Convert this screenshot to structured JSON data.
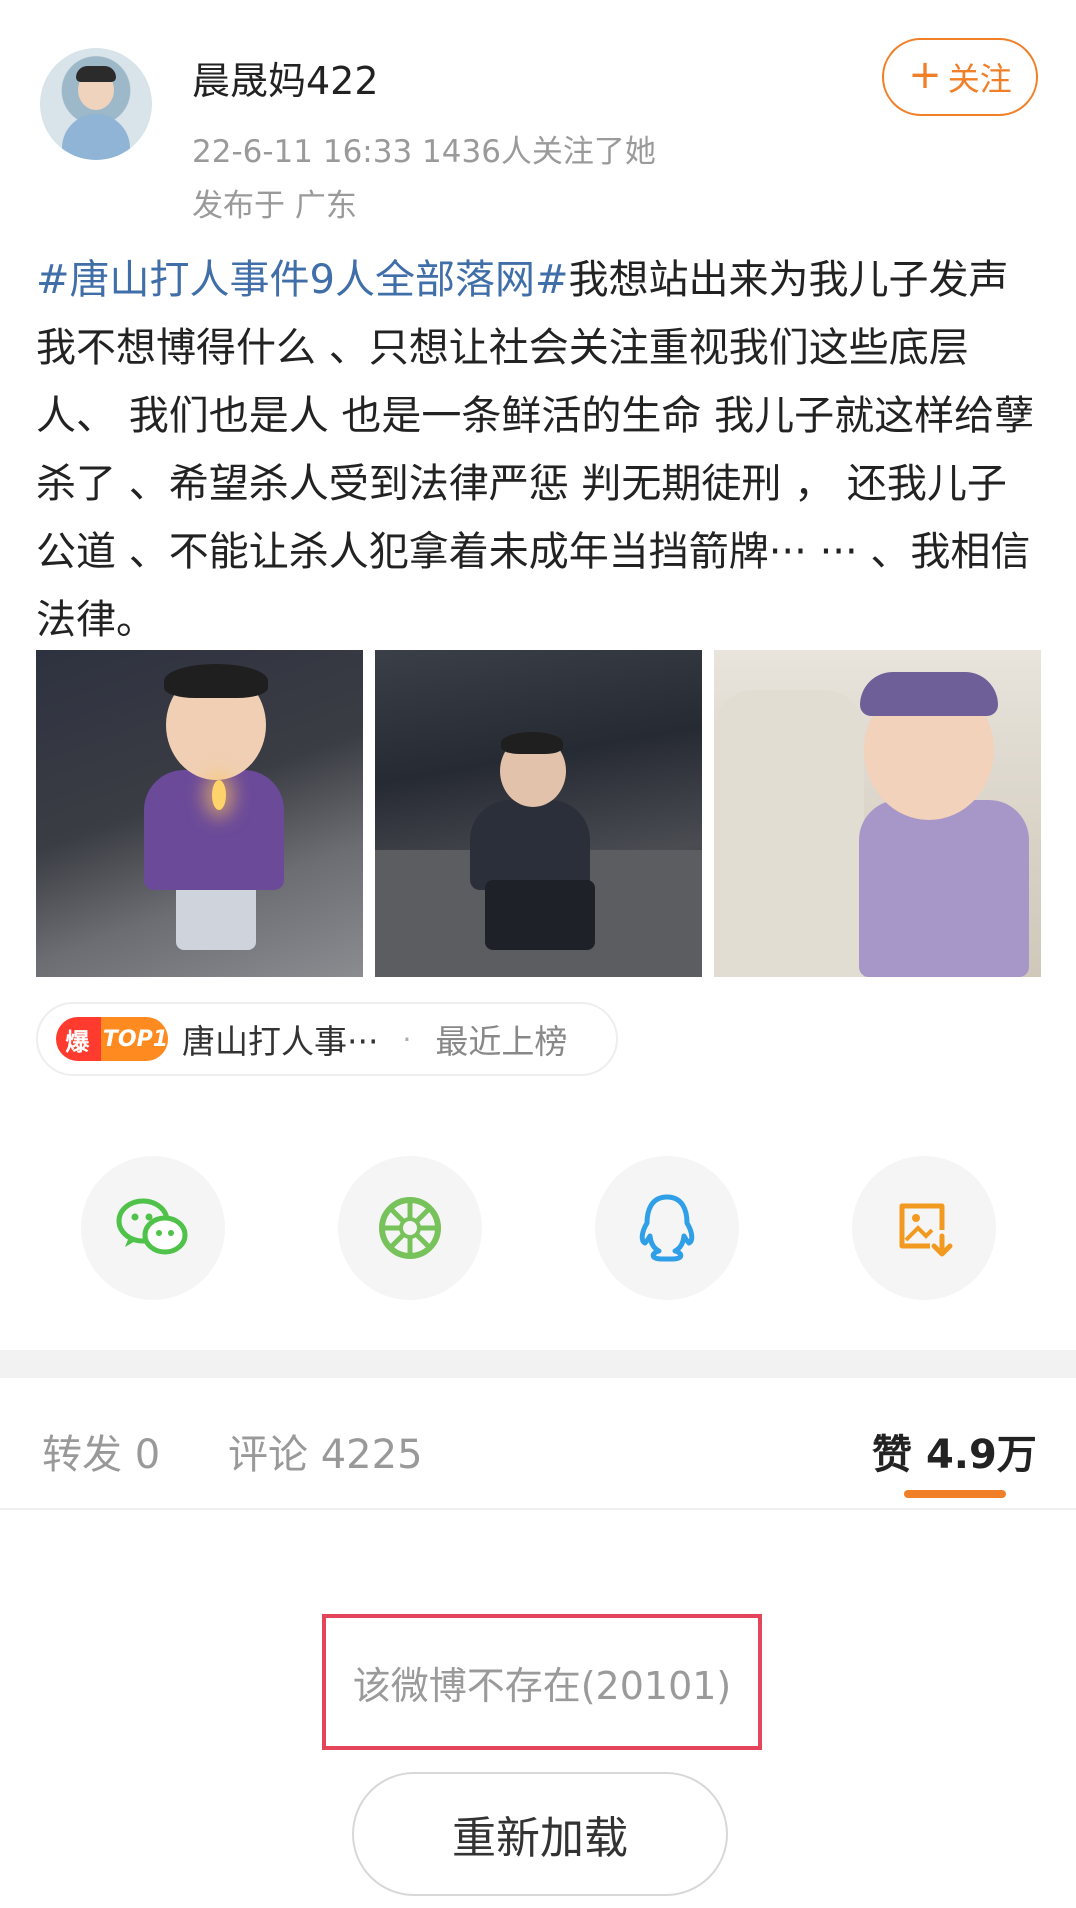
{
  "post": {
    "user_name": "晨晟妈422",
    "meta": "22-6-11 16:33   1436人关注了她",
    "location": "发布于 广东",
    "follow_label": "关注",
    "hashtag": "#唐山打人事件9人全部落网#",
    "body": "我想站出来为我儿子发声 我不想博得什么 、只想让社会关注重视我们这些底层人、 我们也是人 也是一条鲜活的生命 我儿子就这样给孽杀了 、希望杀人受到法律严惩 判无期徒刑 ， 还我儿子公道 、不能让杀人犯拿着未成年当挡箭牌··· ···  、我相信法律。"
  },
  "topic": {
    "badge_char": "爆",
    "badge_rank": "TOP1",
    "name": "唐山打人事···",
    "separator": "·",
    "status": "最近上榜"
  },
  "share": [
    {
      "icon": "wechat-icon",
      "color": "#4fc24a"
    },
    {
      "icon": "moments-icon",
      "color": "#77c25a"
    },
    {
      "icon": "qq-icon",
      "color": "#2f9fe8"
    },
    {
      "icon": "save-image-icon",
      "color": "#f29a1f"
    }
  ],
  "stats": {
    "repost_label": "转发",
    "repost_count": "0",
    "comment_label": "评论",
    "comment_count": "4225",
    "like_label": "赞",
    "like_count": "4.9万"
  },
  "error": {
    "message": "该微博不存在(20101)",
    "reload_label": "重新加载"
  },
  "colors": {
    "accent": "#f17f28",
    "link": "#3f6ea8",
    "highlight_box": "#e5455a"
  }
}
